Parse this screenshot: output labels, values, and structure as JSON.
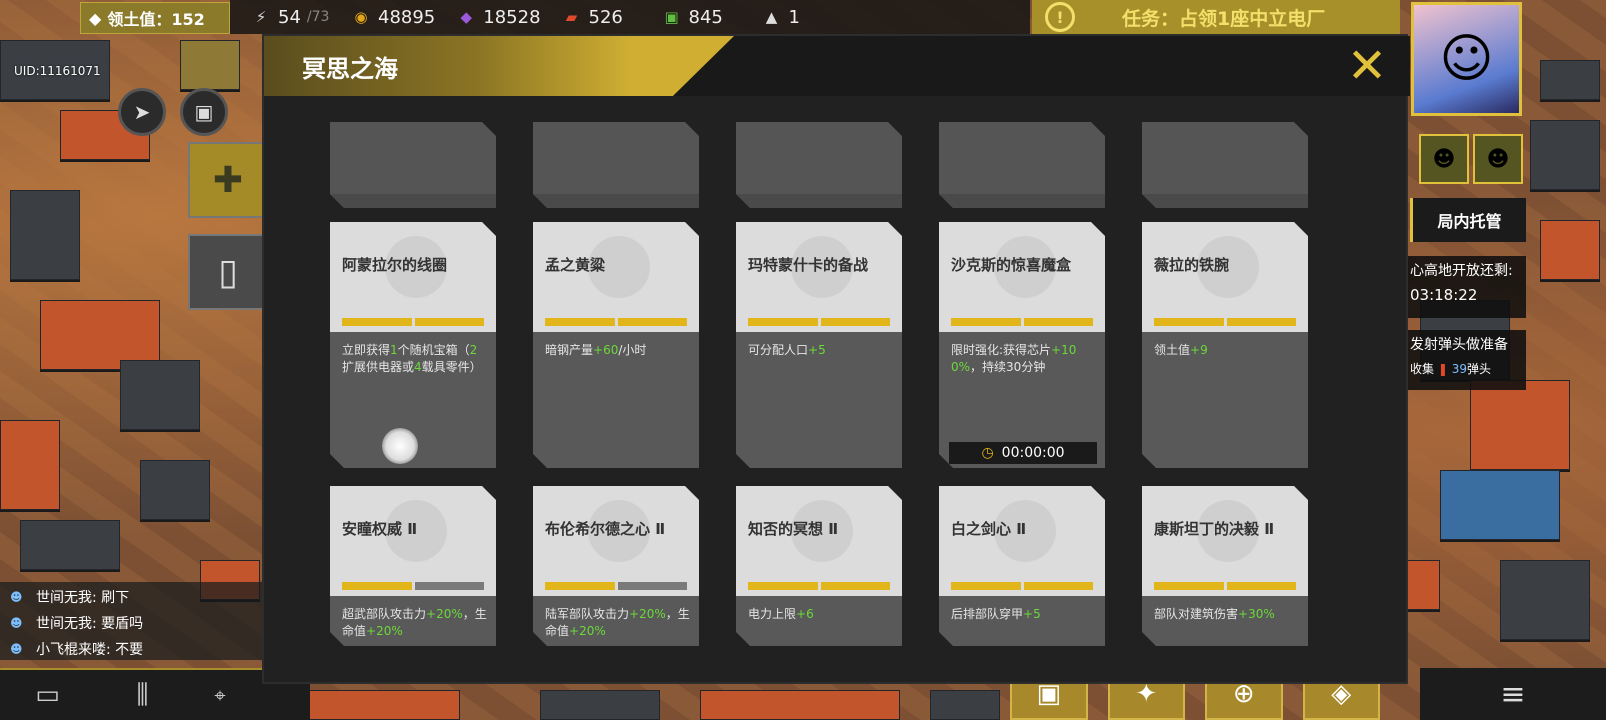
{
  "topbar": {
    "territory_label": "领土值：152",
    "resources": [
      {
        "icon": "energy-icon",
        "value": "54",
        "max": "/73",
        "color": "#d9d9d9"
      },
      {
        "icon": "gold-coin-icon",
        "value": "48895",
        "color": "#e2a51a"
      },
      {
        "icon": "purple-crystal-icon",
        "value": "18528",
        "color": "#9a5ad9"
      },
      {
        "icon": "fuel-can-icon",
        "value": "526",
        "color": "#e04a2a"
      },
      {
        "icon": "chip-icon",
        "value": "845",
        "color": "#5fbf3f"
      },
      {
        "icon": "missile-icon",
        "value": "1",
        "color": "#dddddd"
      }
    ],
    "task": "任务：占领1座中立电厂"
  },
  "uid": "UID:11161071",
  "chat": [
    {
      "text": "世间无我: 刷下"
    },
    {
      "text": "世间无我: 要盾吗"
    },
    {
      "text": "小飞棍来喽: 不要"
    }
  ],
  "right_panel": {
    "auto_button": "局内托管",
    "info1_line1": "心高地开放还剩:",
    "info1_line2": "03:18:22",
    "info2_line1": "发射弹头做准备",
    "info2_pre": "收集",
    "info2_num": "39",
    "info2_post": "弹头"
  },
  "modal": {
    "title": "冥思之海",
    "cards": [
      {
        "name": "",
        "desc": []
      },
      {
        "name": "",
        "desc": []
      },
      {
        "name": "",
        "desc": []
      },
      {
        "name": "",
        "desc": []
      },
      {
        "name": "",
        "desc": []
      },
      {
        "name": "阿蒙拉尔的线圈",
        "progress": [
          1,
          1
        ],
        "desc": [
          {
            "t": "立即获得"
          },
          {
            "t": "1",
            "g": true
          },
          {
            "t": "个随机宝箱（"
          },
          {
            "t": "2",
            "g": true
          },
          {
            "t": "扩展供电器或"
          },
          {
            "t": "4",
            "g": true
          },
          {
            "t": "载具零件）"
          }
        ]
      },
      {
        "name": "孟之黄粱",
        "progress": [
          1,
          1
        ],
        "desc": [
          {
            "t": "暗钢产量"
          },
          {
            "t": "+60",
            "g": true
          },
          {
            "t": "/小时"
          }
        ]
      },
      {
        "name": "玛特蒙什卡的备战",
        "progress": [
          1,
          1
        ],
        "desc": [
          {
            "t": "可分配人口"
          },
          {
            "t": "+5",
            "g": true
          }
        ]
      },
      {
        "name": "沙克斯的惊喜魔盒",
        "progress": [
          1,
          1
        ],
        "timer": "00:00:00",
        "desc": [
          {
            "t": "限时强化:获得芯片"
          },
          {
            "t": "+100%",
            "g": true
          },
          {
            "t": "，持续30分钟"
          }
        ]
      },
      {
        "name": "薇拉的铁腕",
        "progress": [
          1,
          1
        ],
        "desc": [
          {
            "t": "领土值"
          },
          {
            "t": "+9",
            "g": true
          }
        ]
      },
      {
        "name": "安瞳权威 Ⅱ",
        "progress": [
          1,
          0
        ],
        "desc": [
          {
            "t": "超武部队攻击力"
          },
          {
            "t": "+20%",
            "g": true
          },
          {
            "t": "，生命值"
          },
          {
            "t": "+20%",
            "g": true
          }
        ]
      },
      {
        "name": "布伦希尔德之心 Ⅱ",
        "progress": [
          1,
          0
        ],
        "desc": [
          {
            "t": "陆军部队攻击力"
          },
          {
            "t": "+20%",
            "g": true
          },
          {
            "t": "，生命值"
          },
          {
            "t": "+20%",
            "g": true
          }
        ]
      },
      {
        "name": "知否的冥想 Ⅱ",
        "progress": [
          1,
          1
        ],
        "desc": [
          {
            "t": "电力上限"
          },
          {
            "t": "+6",
            "g": true
          }
        ]
      },
      {
        "name": "白之剑心 Ⅱ",
        "progress": [
          1,
          1
        ],
        "desc": [
          {
            "t": "后排部队穿甲"
          },
          {
            "t": "+5",
            "g": true
          }
        ]
      },
      {
        "name": "康斯坦丁的决毅 Ⅱ",
        "progress": [
          1,
          1
        ],
        "desc": [
          {
            "t": "部队对建筑伤害"
          },
          {
            "t": "+30%",
            "g": true
          }
        ]
      }
    ]
  },
  "colors": {
    "accent": "#e2b51a",
    "bonus_green": "#6bd93a",
    "modal_bg": "#212121"
  }
}
